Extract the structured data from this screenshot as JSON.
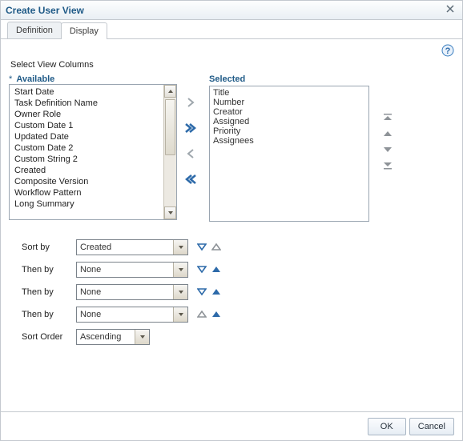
{
  "dialog": {
    "title": "Create User View"
  },
  "tabs": {
    "definition": "Definition",
    "display": "Display",
    "activeIndex": 1
  },
  "section": {
    "selectViewColumns": "Select View Columns"
  },
  "available": {
    "header": "Available",
    "items": [
      "Start Date",
      "Task Definition Name",
      "Owner Role",
      "Custom Date 1",
      "Updated Date",
      "Custom Date 2",
      "Custom String 2",
      "Created",
      "Composite Version",
      "Workflow Pattern",
      "Long Summary"
    ]
  },
  "selected": {
    "header": "Selected",
    "items": [
      "Title",
      "Number",
      "Creator",
      "Assigned",
      "Priority",
      "Assignees"
    ]
  },
  "sort": {
    "labels": {
      "sortBy": "Sort by",
      "thenBy": "Then by",
      "sortOrder": "Sort Order"
    },
    "rows": [
      {
        "value": "Created"
      },
      {
        "value": "None"
      },
      {
        "value": "None"
      },
      {
        "value": "None"
      }
    ],
    "order": "Ascending"
  },
  "footer": {
    "ok": "OK",
    "cancel": "Cancel"
  },
  "colors": {
    "accent": "#2d6aa9",
    "linkBlue": "#1f5a87"
  }
}
